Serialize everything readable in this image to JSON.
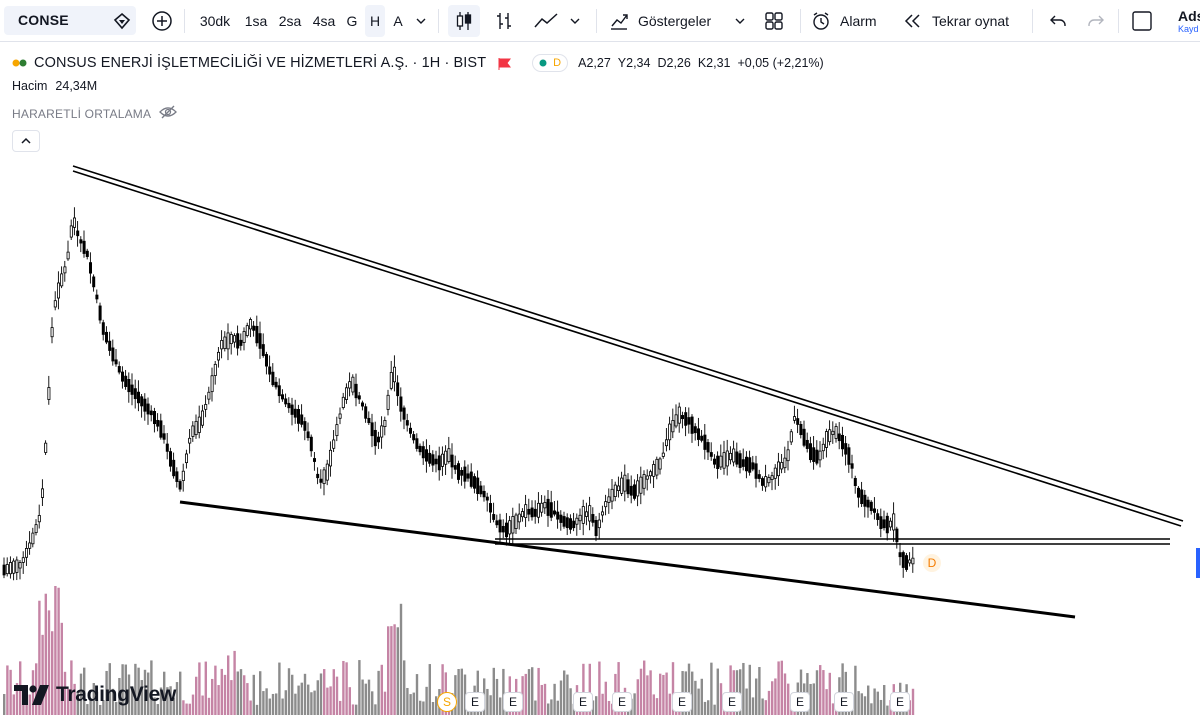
{
  "toolbar": {
    "symbol": "CONSE",
    "intervals": [
      "30dk",
      "1sa",
      "2sa",
      "4sa",
      "G",
      "H",
      "A"
    ],
    "active_interval": "H",
    "indicators_label": "Göstergeler",
    "alarm_label": "Alarm",
    "replay_label": "Tekrar oynat",
    "right_cut_label": "Ads",
    "right_cut_sub": "Kayd"
  },
  "legend": {
    "title": "CONSUS ENERJİ İŞLETMECİLİĞİ VE HİZMETLERİ A.Ş. · 1H · BIST",
    "status_badge": "D",
    "open": "A2,27",
    "high": "Y2,34",
    "low": "D2,26",
    "close": "K2,31",
    "change": "+0,05 (+2,21%)",
    "volume_label": "Hacim",
    "volume_value": "24,34M",
    "indicator_name": "HARARETLİ ORTALAMA"
  },
  "events": {
    "split_label": "S",
    "earnings_label": "E",
    "dividend_label": "D"
  },
  "colors": {
    "candle": "#000000",
    "volume_up": "#c584a5",
    "volume_down": "#8c8c8c",
    "accent": "#2962ff",
    "trendline": "#000000",
    "badge_orange": "#f7a600"
  },
  "branding": {
    "logo_text": "TradingView"
  }
}
